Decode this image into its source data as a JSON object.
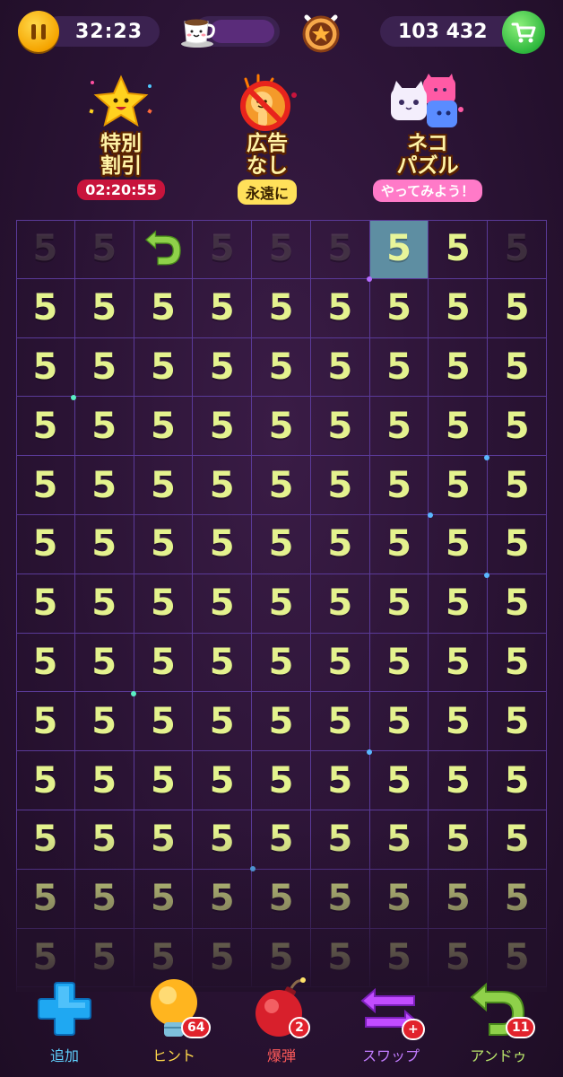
{
  "top_bar": {
    "timer": "32:23",
    "coins": "103 432",
    "icons": [
      "pause-icon",
      "coffee-cup-icon",
      "star-badge-icon",
      "shopping-cart-icon"
    ]
  },
  "promos": [
    {
      "title_line1": "特別",
      "title_line2": "割引",
      "tag": "02:20:55",
      "tag_bg": "#c8143c",
      "tag_color": "#ffffff"
    },
    {
      "title_line1": "広告",
      "title_line2": "なし",
      "tag": "永遠に",
      "tag_bg": "#ffe05a",
      "tag_color": "#3a2200"
    },
    {
      "title_line1": "ネコ",
      "title_line2": "パズル",
      "tag": "やってみよう！",
      "tag_bg": "#ff7ac8",
      "tag_color": "#ffffff"
    }
  ],
  "board": {
    "columns": 9,
    "cell_value": "5",
    "first_row": [
      "5",
      "5",
      "↩",
      "5",
      "5",
      "5",
      "5",
      "5",
      "5"
    ],
    "first_row_states": [
      "dim",
      "dim",
      "undo",
      "dim",
      "dim",
      "dim",
      "selected",
      "normal",
      "dim"
    ],
    "rows": 13,
    "number_color": "#e4f28e",
    "grid_color": "#5a3a98"
  },
  "toolbar": {
    "items": [
      {
        "label": "追加",
        "count": "",
        "label_color": "#5fd1ff"
      },
      {
        "label": "ヒント",
        "count": "64",
        "label_color": "#ffd84a"
      },
      {
        "label": "爆弾",
        "count": "2",
        "label_color": "#ff5a5a"
      },
      {
        "label": "スワップ",
        "count": "+",
        "label_color": "#c27cff"
      },
      {
        "label": "アンドゥ",
        "count": "11",
        "label_color": "#b8e36a"
      }
    ]
  }
}
